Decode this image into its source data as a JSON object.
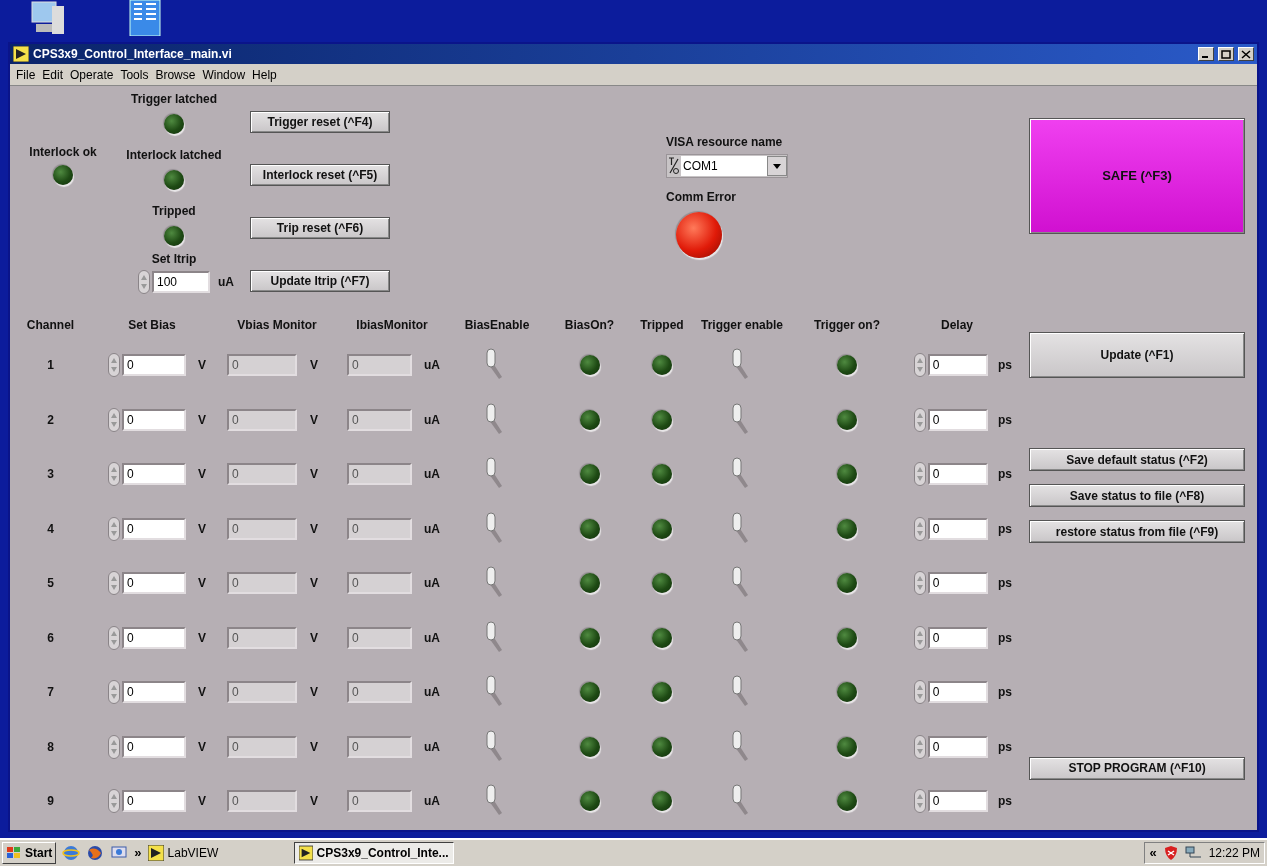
{
  "window": {
    "title": "CPS3x9_Control_Interface_main.vi"
  },
  "menu": [
    "File",
    "Edit",
    "Operate",
    "Tools",
    "Browse",
    "Window",
    "Help"
  ],
  "trigger_latched": {
    "label": "Trigger latched",
    "on": false
  },
  "interlock_ok": {
    "label": "Interlock ok",
    "on": false
  },
  "interlock_latched": {
    "label": "Interlock latched",
    "on": false
  },
  "tripped": {
    "label": "Tripped",
    "on": false
  },
  "set_itrip": {
    "label": "Set Itrip",
    "value": "100",
    "unit": "uA"
  },
  "reset_buttons": [
    "Trigger reset (^F4)",
    "Interlock reset (^F5)",
    "Trip reset (^F6)",
    "Update Itrip (^F7)"
  ],
  "visa": {
    "label": "VISA resource name",
    "value": "COM1"
  },
  "comm_error": {
    "label": "Comm Error",
    "on": true
  },
  "safe_button": "SAFE (^F3)",
  "columns": [
    "Channel",
    "Set Bias",
    "Vbias Monitor",
    "IbiasMonitor",
    "BiasEnable",
    "BiasOn?",
    "Tripped",
    "Trigger enable",
    "Trigger on?",
    "Delay"
  ],
  "channels": [
    {
      "channel": "1",
      "set_bias": "0",
      "bias_unit": "V",
      "vbias": "0",
      "vbias_unit": "V",
      "ibias": "0",
      "ibias_unit": "uA",
      "bias_enable": false,
      "bias_on": false,
      "tripped": false,
      "trigger_enable": false,
      "trigger_on": false,
      "delay": "0",
      "delay_unit": "ps"
    },
    {
      "channel": "2",
      "set_bias": "0",
      "bias_unit": "V",
      "vbias": "0",
      "vbias_unit": "V",
      "ibias": "0",
      "ibias_unit": "uA",
      "bias_enable": false,
      "bias_on": false,
      "tripped": false,
      "trigger_enable": false,
      "trigger_on": false,
      "delay": "0",
      "delay_unit": "ps"
    },
    {
      "channel": "3",
      "set_bias": "0",
      "bias_unit": "V",
      "vbias": "0",
      "vbias_unit": "V",
      "ibias": "0",
      "ibias_unit": "uA",
      "bias_enable": false,
      "bias_on": false,
      "tripped": false,
      "trigger_enable": false,
      "trigger_on": false,
      "delay": "0",
      "delay_unit": "ps"
    },
    {
      "channel": "4",
      "set_bias": "0",
      "bias_unit": "V",
      "vbias": "0",
      "vbias_unit": "V",
      "ibias": "0",
      "ibias_unit": "uA",
      "bias_enable": false,
      "bias_on": false,
      "tripped": false,
      "trigger_enable": false,
      "trigger_on": false,
      "delay": "0",
      "delay_unit": "ps"
    },
    {
      "channel": "5",
      "set_bias": "0",
      "bias_unit": "V",
      "vbias": "0",
      "vbias_unit": "V",
      "ibias": "0",
      "ibias_unit": "uA",
      "bias_enable": false,
      "bias_on": false,
      "tripped": false,
      "trigger_enable": false,
      "trigger_on": false,
      "delay": "0",
      "delay_unit": "ps"
    },
    {
      "channel": "6",
      "set_bias": "0",
      "bias_unit": "V",
      "vbias": "0",
      "vbias_unit": "V",
      "ibias": "0",
      "ibias_unit": "uA",
      "bias_enable": false,
      "bias_on": false,
      "tripped": false,
      "trigger_enable": false,
      "trigger_on": false,
      "delay": "0",
      "delay_unit": "ps"
    },
    {
      "channel": "7",
      "set_bias": "0",
      "bias_unit": "V",
      "vbias": "0",
      "vbias_unit": "V",
      "ibias": "0",
      "ibias_unit": "uA",
      "bias_enable": false,
      "bias_on": false,
      "tripped": false,
      "trigger_enable": false,
      "trigger_on": false,
      "delay": "0",
      "delay_unit": "ps"
    },
    {
      "channel": "8",
      "set_bias": "0",
      "bias_unit": "V",
      "vbias": "0",
      "vbias_unit": "V",
      "ibias": "0",
      "ibias_unit": "uA",
      "bias_enable": false,
      "bias_on": false,
      "tripped": false,
      "trigger_enable": false,
      "trigger_on": false,
      "delay": "0",
      "delay_unit": "ps"
    },
    {
      "channel": "9",
      "set_bias": "0",
      "bias_unit": "V",
      "vbias": "0",
      "vbias_unit": "V",
      "ibias": "0",
      "ibias_unit": "uA",
      "bias_enable": false,
      "bias_on": false,
      "tripped": false,
      "trigger_enable": false,
      "trigger_on": false,
      "delay": "0",
      "delay_unit": "ps"
    }
  ],
  "update_button": "Update (^F1)",
  "file_buttons": [
    "Save default status (^F2)",
    "Save status to file (^F8)",
    "restore status from file (^F9)"
  ],
  "stop_button": "STOP PROGRAM (^F10)",
  "taskbar": {
    "start": "Start",
    "more": "»",
    "toolbar_item": "LabVIEW",
    "tasks": [
      {
        "label": "CPS3x9_Control_Inte...",
        "selected": true
      }
    ],
    "tray_expand": "«",
    "clock": "12:22 PM"
  }
}
